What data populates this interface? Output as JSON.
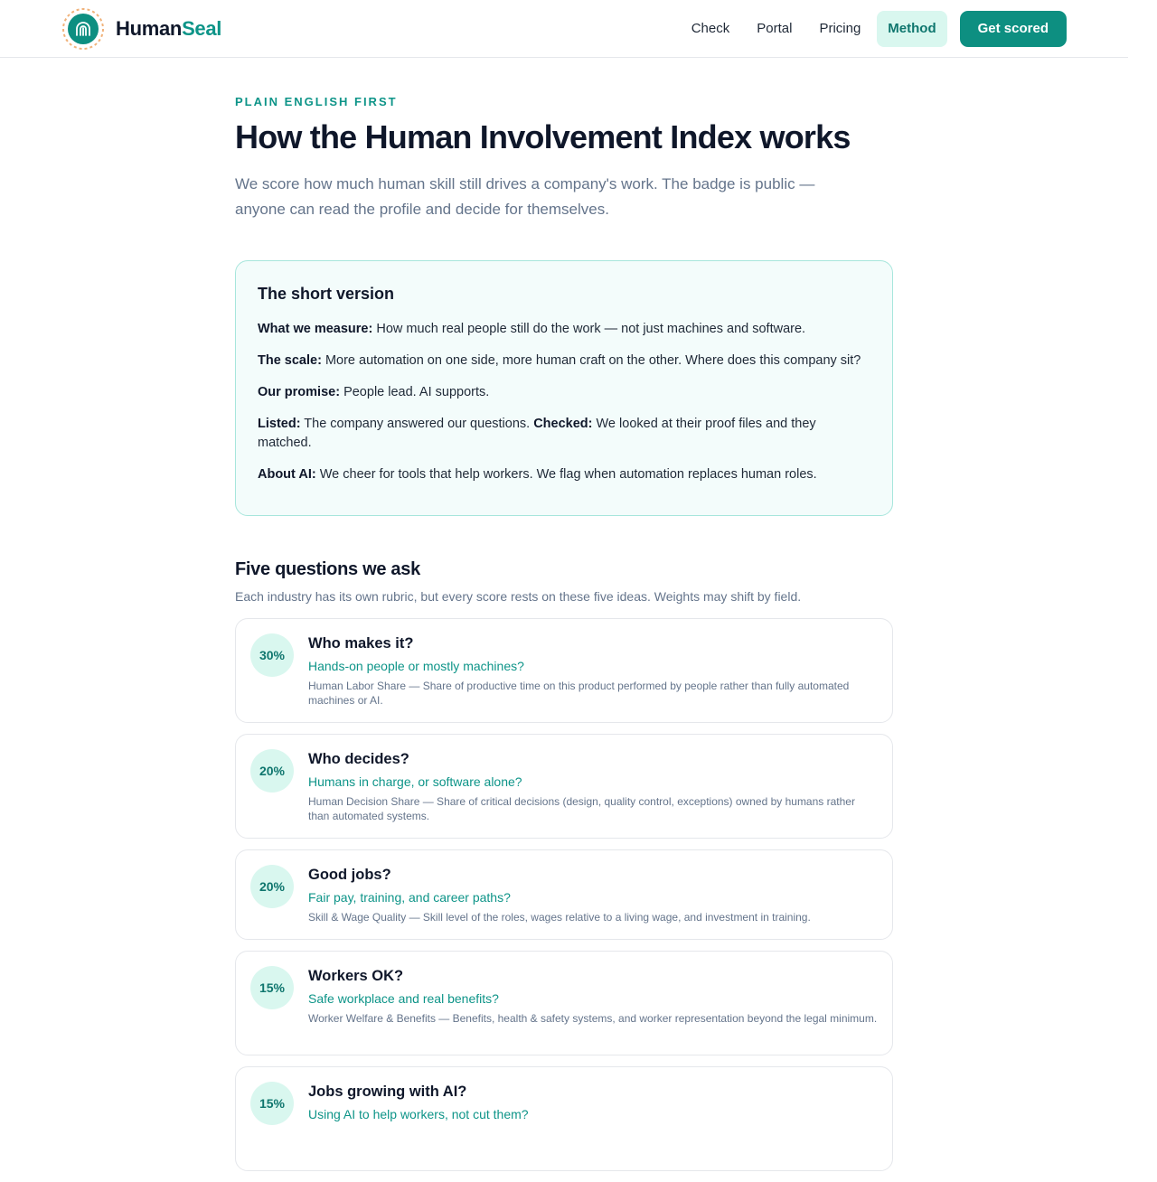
{
  "brand": {
    "name_part1": "Human",
    "name_part2": "Seal"
  },
  "nav": {
    "items": [
      {
        "label": "Check"
      },
      {
        "label": "Portal"
      },
      {
        "label": "Pricing"
      },
      {
        "label": "Method",
        "active": true
      }
    ],
    "cta_label": "Get scored"
  },
  "hero": {
    "eyebrow": "PLAIN ENGLISH FIRST",
    "title": "How the Human Involvement Index works",
    "lead": "We score how much human skill still drives a company's work. The badge is public — anyone can read the profile and decide for themselves."
  },
  "short_version": {
    "title": "The short version",
    "rows": [
      {
        "label": "What we measure:",
        "text": " How much real people still do the work — not just machines and software."
      },
      {
        "label": "The scale:",
        "text": " More automation on one side, more human craft on the other. Where does this company sit?"
      },
      {
        "label": "Our promise:",
        "text": " People lead. AI supports."
      },
      {
        "label": "Listed:",
        "text": " The company answered our questions. ",
        "label2": "Checked:",
        "text2": " We looked at their proof files and they matched."
      },
      {
        "label": "About AI:",
        "text": " We cheer for tools that help workers. We flag when automation replaces human roles."
      }
    ]
  },
  "questions": {
    "title": "Five questions we ask",
    "subtitle": "Each industry has its own rubric, but every score rests on these five ideas. Weights may shift by field.",
    "cards": [
      {
        "weight": "30%",
        "title": "Who makes it?",
        "question": "Hands-on people or mostly machines?",
        "desc": "Human Labor Share — Share of productive time on this product performed by people rather than fully automated machines or AI."
      },
      {
        "weight": "20%",
        "title": "Who decides?",
        "question": "Humans in charge, or software alone?",
        "desc": "Human Decision Share — Share of critical decisions (design, quality control, exceptions) owned by humans rather than automated systems."
      },
      {
        "weight": "20%",
        "title": "Good jobs?",
        "question": "Fair pay, training, and career paths?",
        "desc": "Skill & Wage Quality — Skill level of the roles, wages relative to a living wage, and investment in training."
      },
      {
        "weight": "15%",
        "title": "Workers OK?",
        "question": "Safe workplace and real benefits?",
        "desc": "Worker Welfare & Benefits — Benefits, health & safety systems, and worker representation beyond the legal minimum."
      },
      {
        "weight": "15%",
        "title": "Jobs growing with AI?",
        "question": "Using AI to help workers, not cut them?",
        "desc": ""
      }
    ]
  },
  "colors": {
    "accent": "#0d9488",
    "cta": "#0d8f81",
    "badge_bg": "#d9f7ef"
  }
}
